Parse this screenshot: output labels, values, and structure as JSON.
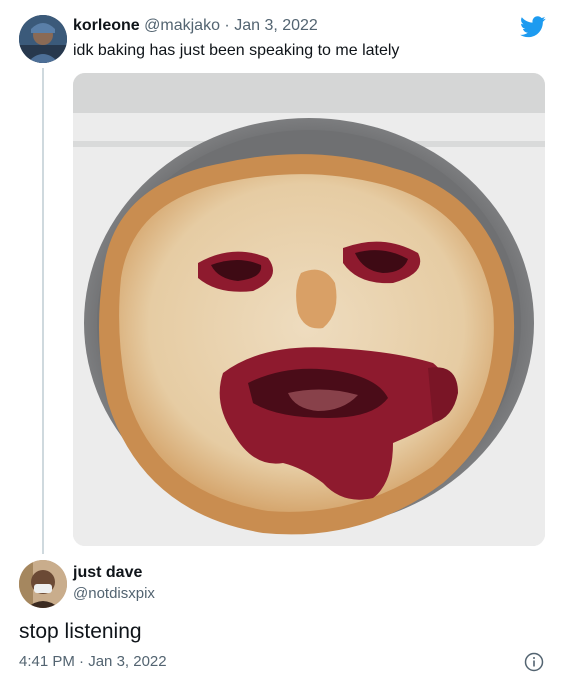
{
  "tweet": {
    "display_name": "korleone",
    "handle": "@makjako",
    "separator": "·",
    "date": "Jan 3, 2022",
    "text": "idk baking has just been speaking to me lately",
    "photo_alt": "pie with a face"
  },
  "reply": {
    "display_name": "just dave",
    "handle": "@notdisxpix",
    "text": "stop listening",
    "time": "4:41 PM",
    "separator": "·",
    "date": "Jan 3, 2022"
  },
  "icons": {
    "brand": "twitter-bird-icon",
    "info": "info-icon"
  },
  "colors": {
    "twitter_blue": "#1d9bf0",
    "muted": "#536471",
    "text": "#0f1419",
    "thread_line": "#cfd9de"
  }
}
